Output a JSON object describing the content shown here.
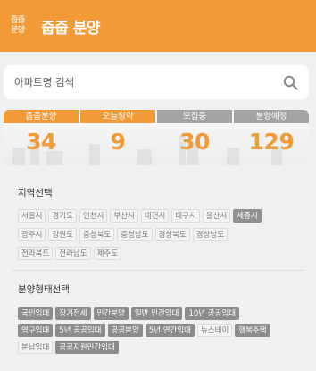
{
  "header": {
    "logo_line1": "줍줍",
    "logo_line2": "분양",
    "title": "줍줍 분양",
    "color": "#f29a35"
  },
  "search": {
    "placeholder": "아파트명 검색",
    "icon": "search-icon"
  },
  "stats": [
    {
      "label": "줍줍분양",
      "value": "34",
      "style": "orange"
    },
    {
      "label": "오늘청약",
      "value": "9",
      "style": "orange"
    },
    {
      "label": "모집중",
      "value": "30",
      "style": "gray"
    },
    {
      "label": "분양예정",
      "value": "129",
      "style": "gray"
    }
  ],
  "region": {
    "title": "지역선택",
    "rows": [
      [
        "서울시",
        "경기도",
        "인천시",
        "부산시",
        "대전시",
        "대구시",
        "울산시",
        "세종시"
      ],
      [
        "광주시",
        "강원도",
        "충청북도",
        "충청남도",
        "경상북도",
        "경상남도"
      ],
      [
        "전라북도",
        "전라남도",
        "제주도"
      ]
    ],
    "active": "세종시"
  },
  "type": {
    "title": "분양형태선택",
    "rows": [
      [
        "국민임대",
        "장기전세",
        "민간분양",
        "일반 민간임대",
        "10년 공공임대"
      ],
      [
        "영구임대",
        "5년 공공임대",
        "공공분양",
        "5년 연간임대",
        "뉴스테이",
        "행복주택"
      ],
      [
        "분납임대",
        "공공지원민간임대"
      ]
    ],
    "inactive": [
      "뉴스테이"
    ]
  },
  "colors": {
    "accent": "#f29a35",
    "gray_label": "#a3a3a3",
    "tag_active": "#909090"
  }
}
